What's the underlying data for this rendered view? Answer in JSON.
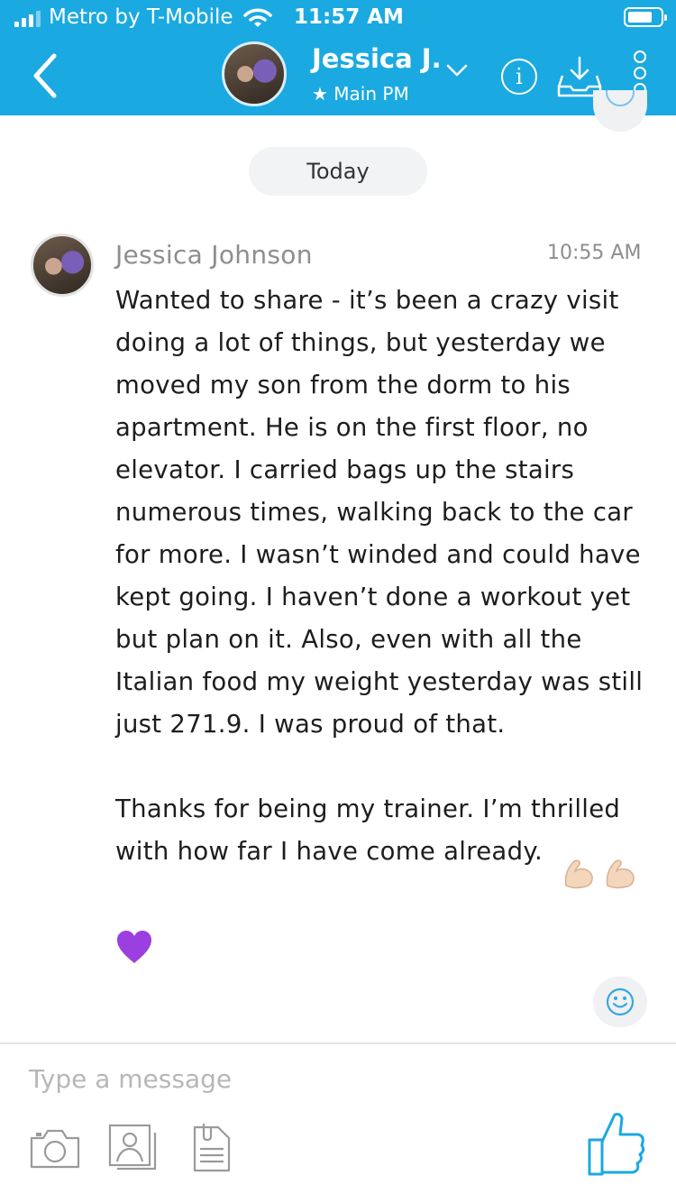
{
  "status_bar": {
    "carrier": "Metro by T-Mobile",
    "time": "11:57 AM"
  },
  "header": {
    "contact_name": "Jessica J.",
    "contact_subtitle": "★ Main PM",
    "icons": [
      "back-arrow-icon",
      "avatar",
      "chevron-down-icon",
      "info-icon",
      "inbox-download-icon",
      "more-vertical-icon"
    ],
    "accent_color": "#1ba9e1"
  },
  "conversation": {
    "date_divider": "Today",
    "messages": [
      {
        "sender": "Jessica Johnson",
        "time": "10:55 AM",
        "text": "Wanted to share - it’s been a crazy visit doing a lot of things, but yesterday we moved my son from the dorm to his apartment. He is on the first floor, no elevator. I carried bags up the stairs numerous times, walking back to the car for more. I wasn’t winded and could have kept going. I haven’t done a workout yet but plan on it. Also, even with all the Italian food my weight yesterday was still just 271.9. I was proud of that.\n\nThanks for being my trainer. I’m thrilled with how far I have come already.",
        "emojis": [
          "flexed-biceps-emoji",
          "flexed-biceps-emoji",
          "purple-heart-emoji"
        ]
      }
    ]
  },
  "composer": {
    "placeholder": "Type a message",
    "tools": [
      "camera-icon",
      "photo-icon",
      "document-icon",
      "thumbs-up-icon"
    ]
  }
}
